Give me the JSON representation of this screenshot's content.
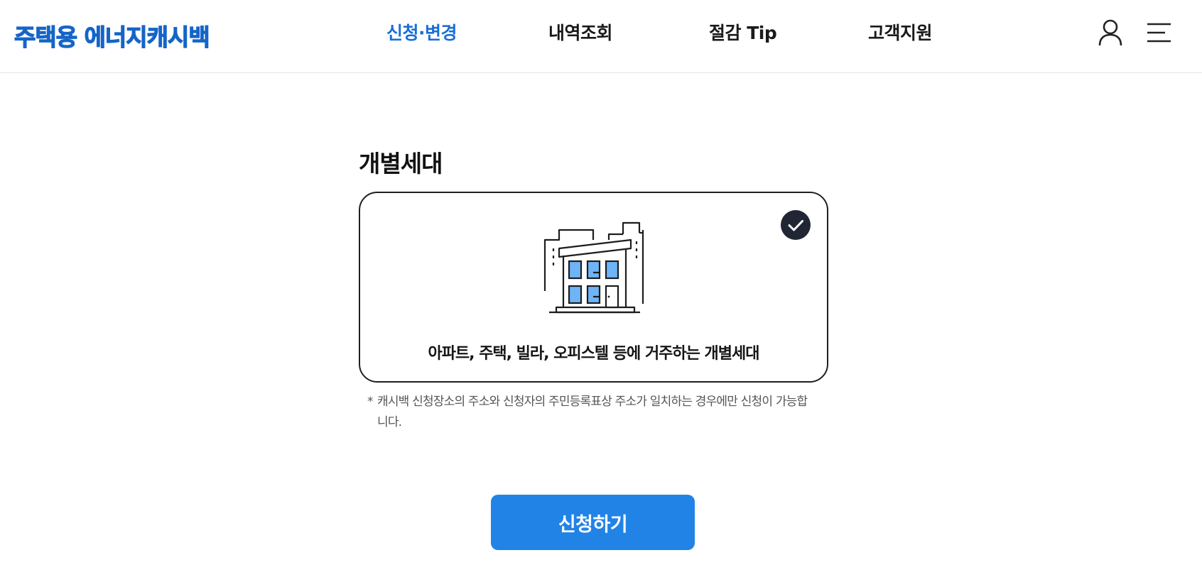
{
  "header": {
    "logo": "주택용 에너지캐시백",
    "nav": [
      {
        "label": "신청·변경",
        "active": true
      },
      {
        "label": "내역조회",
        "active": false
      },
      {
        "label": "절감 Tip",
        "active": false
      },
      {
        "label": "고객지원",
        "active": false
      }
    ],
    "icons": {
      "user": "user-icon",
      "menu": "hamburger-menu-icon"
    }
  },
  "main": {
    "section_title": "개별세대",
    "card": {
      "selected": true,
      "icon": "building-icon",
      "description": "아파트, 주택, 빌라, 오피스텔 등에 거주하는 개별세대"
    },
    "note": {
      "marker": "*",
      "text": "캐시백 신청장소의 주소와 신청자의 주민등록표상 주소가 일치하는 경우에만 신청이 가능합니다."
    },
    "apply_button": "신청하기"
  },
  "colors": {
    "brand_blue": "#1565c8",
    "nav_active": "#1a6fd6",
    "button_blue": "#2283e6",
    "check_badge": "#202633",
    "window_blue": "#6eb4f7"
  }
}
